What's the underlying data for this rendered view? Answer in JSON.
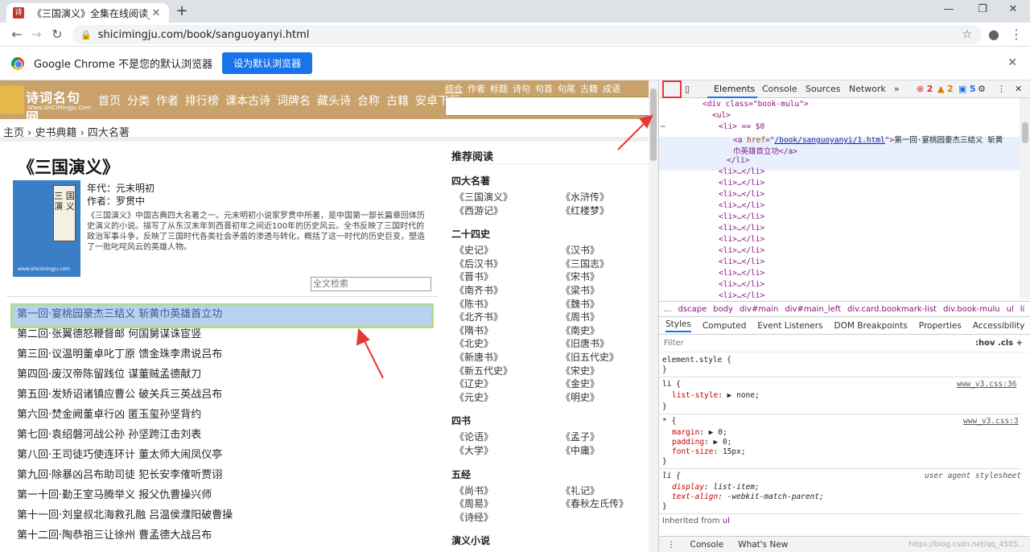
{
  "browser": {
    "tab_title": "《三国演义》全集在线阅读_史书",
    "tab_close": "✕",
    "new_tab": "+",
    "url": "shicimingju.com/book/sanguoyanyi.html",
    "infobar_text": "Google Chrome 不是您的默认浏览器",
    "infobar_button": "设为默认浏览器"
  },
  "site": {
    "logo_text": "诗词名句网",
    "logo_url": "Www.ShiCiMingJu.Com",
    "nav": [
      "首页",
      "分类",
      "作者",
      "排行榜",
      "课本古诗",
      "词牌名",
      "藏头诗",
      "合称",
      "古籍",
      "安卓下载"
    ],
    "search_cats": [
      "综合",
      "作者",
      "标题",
      "诗句",
      "句首",
      "句尾",
      "古籍",
      "成语"
    ],
    "breadcrumb": "主页 › 史书典籍 › 四大名著",
    "book": {
      "title": "《三国演义》",
      "cover_text": "三 国 演 义",
      "cover_site": "www.shicimingju.com",
      "era": "年代：元末明初",
      "author": "作者：罗贯中",
      "desc": "《三国演义》中国古典四大名著之一。元末明初小说家罗贯中所著，是中国第一部长篇章回体历史演义的小说。描写了从东汉末年到西晋初年之间近100年的历史风云。全书反映了三国时代的政治军事斗争，反映了三国时代各类社会矛盾的渗透与转化，概括了这一时代的历史巨变，塑造了一批叱咤风云的英雄人物。",
      "search_placeholder": "全文检索"
    },
    "chapters": [
      "第一回·宴桃园豪杰三结义 斩黄巾英雄首立功",
      "第二回·张翼德怒鞭督邮 何国舅谋诛宦竖",
      "第三回·议温明董卓叱丁原 馈金珠李肃说吕布",
      "第四回·废汉帝陈留践位 谋董贼孟德献刀",
      "第五回·发矫诏诸镇应曹公 破关兵三英战吕布",
      "第六回·焚金阙董卓行凶 匿玉玺孙坚背约",
      "第七回·袁绍磐河战公孙 孙坚跨江击刘表",
      "第八回·王司徒巧使连环计 董太师大闹凤仪亭",
      "第九回·除暴凶吕布助司徒 犯长安李傕听贾诩",
      "第一十回·勤王室马腾举义 报父仇曹操兴师",
      "第十一回·刘皇叔北海救孔融 吕温侯濮阳破曹操",
      "第十二回·陶恭祖三让徐州 曹孟德大战吕布"
    ],
    "sidebar": {
      "heading": "推荐阅读",
      "groups": [
        {
          "title": "四大名著",
          "items": [
            "《三国演义》",
            "《水浒传》",
            "《西游记》",
            "《红楼梦》"
          ]
        },
        {
          "title": "二十四史",
          "items": [
            "《史记》",
            "《汉书》",
            "《后汉书》",
            "《三国志》",
            "《晋书》",
            "《宋书》",
            "《南齐书》",
            "《梁书》",
            "《陈书》",
            "《魏书》",
            "《北齐书》",
            "《周书》",
            "《隋书》",
            "《南史》",
            "《北史》",
            "《旧唐书》",
            "《新唐书》",
            "《旧五代史》",
            "《新五代史》",
            "《宋史》",
            "《辽史》",
            "《金史》",
            "《元史》",
            "《明史》"
          ]
        },
        {
          "title": "四书",
          "items": [
            "《论语》",
            "《孟子》",
            "《大学》",
            "《中庸》"
          ]
        },
        {
          "title": "五经",
          "items": [
            "《尚书》",
            "《礼记》",
            "《周易》",
            "《春秋左氏传》",
            "《诗经》"
          ]
        },
        {
          "title": "演义小说",
          "items": []
        }
      ]
    }
  },
  "devtools": {
    "tabs": [
      "Elements",
      "Console",
      "Sources",
      "Network",
      "»"
    ],
    "errors": "2",
    "warnings": "2",
    "infos": "5",
    "dom": {
      "l1": "<div class=\"book-mulu\">",
      "l2": "<ul>",
      "l3": "<li> == $0",
      "l4_href": "/book/sanguoyanyi/1.html",
      "l4_text": "第一回·宴桃园豪杰三结义  斩黄",
      "l5_text": "巾英雄首立功</a>",
      "l6": "</li>",
      "collapsed": "<li>…</li>"
    },
    "crumbs": [
      "...",
      "dscape",
      "body",
      "div#main",
      "div#main_left",
      "div.card.bookmark-list",
      "div.book-mulu",
      "ul",
      "li"
    ],
    "subtabs": [
      "Styles",
      "Computed",
      "Event Listeners",
      "DOM Breakpoints",
      "Properties",
      "Accessibility"
    ],
    "filter_placeholder": "Filter",
    "filter_right": ":hov  .cls  +",
    "styles": {
      "s1": "element.style {",
      "close": "}",
      "li_rule": "li {",
      "li_prop": "list-style",
      "li_val": "none;",
      "src1": "www_v3.css:36",
      "star_rule": "* {",
      "margin": "margin",
      "padding": "padding",
      "fontsize": "font-size",
      "zero": "0;",
      "fs_val": "15px;",
      "src2": "www_v3.css:3",
      "ua_rule": "li {",
      "ua_label": "user agent stylesheet",
      "display": "display",
      "display_val": "list-item;",
      "textalign": "text-align",
      "textalign_val": "-webkit-match-parent;",
      "inherited": "Inherited from",
      "inherited_tag": "ul"
    },
    "drawer": [
      "Console",
      "What's New"
    ],
    "watermark": "https://blog.csdn.net/qq_4585..."
  }
}
